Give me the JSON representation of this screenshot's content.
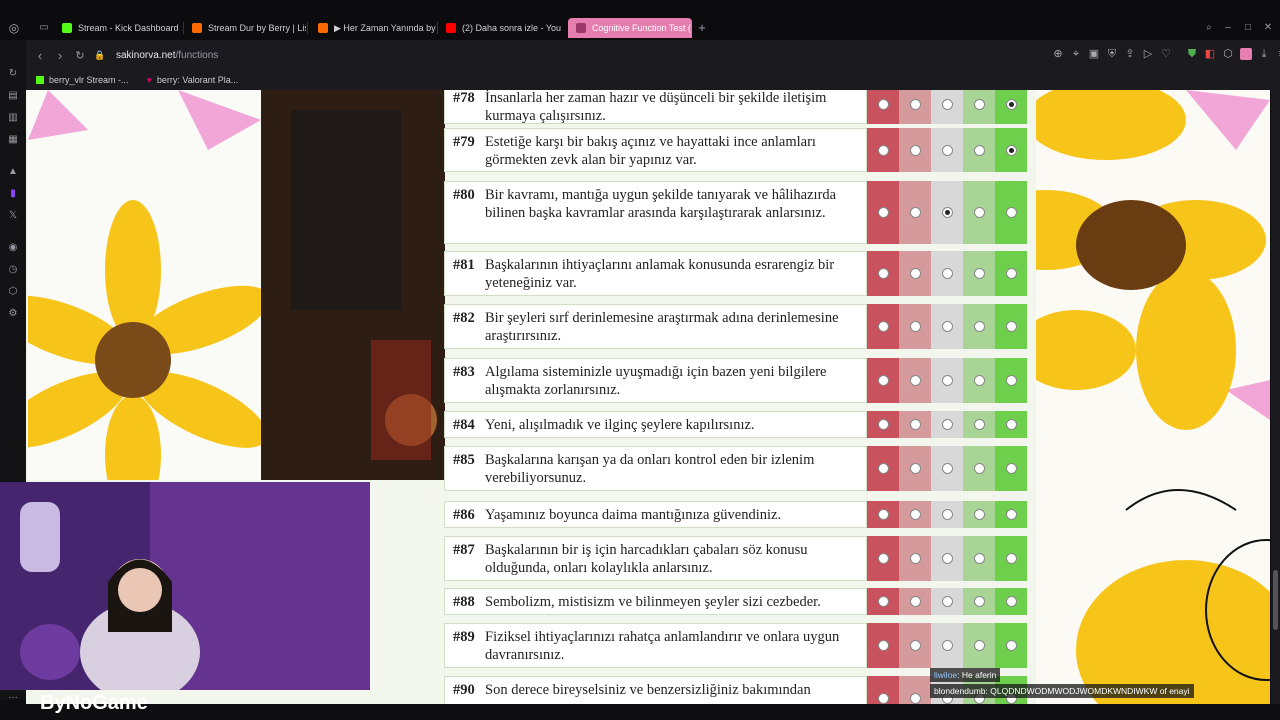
{
  "tabs": [
    {
      "label": "Stream - Kick Dashboard",
      "color": "#53fc18"
    },
    {
      "label": "Stream Dur by Berry | List",
      "color": "#ff6a00"
    },
    {
      "label": "▶ Her Zaman Yanında by",
      "color": "#ff6a00"
    },
    {
      "label": "(2) Daha sonra izle - You",
      "color": "#ff0000"
    },
    {
      "label": "Cognitive Function Test (",
      "color": "#e67eb0"
    }
  ],
  "address": {
    "domain": "sakinorva.net",
    "path": "/functions"
  },
  "bookmarks": [
    {
      "label": "berry_vlr Stream -..."
    },
    {
      "label": "berry: Valorant Pla..."
    }
  ],
  "questions": [
    {
      "num": "#78",
      "text": "İnsanlarla her zaman hazır ve düşünceli bir şekilde iletişim kurmaya çalışırsınız.",
      "selected": 4
    },
    {
      "num": "#79",
      "text": "Estetiğe karşı bir bakış açınız ve hayattaki ince anlamları görmekten zevk alan bir yapınız var.",
      "selected": 4
    },
    {
      "num": "#80",
      "text": "Bir kavramı, mantığa uygun şekilde tanıyarak ve hâlihazırda bilinen başka kavramlar arasında karşılaştırarak anlarsınız.",
      "selected": 2
    },
    {
      "num": "#81",
      "text": "Başkalarının ihtiyaçlarını anlamak konusunda esrarengiz bir yeteneğiniz var.",
      "selected": -1
    },
    {
      "num": "#82",
      "text": "Bir şeyleri sırf derinlemesine araştırmak adına derinlemesine araştırırsınız.",
      "selected": -1
    },
    {
      "num": "#83",
      "text": "Algılama sisteminizle uyuşmadığı için bazen yeni bilgilere alışmakta zorlanırsınız.",
      "selected": -1
    },
    {
      "num": "#84",
      "text": "Yeni, alışılmadık ve ilginç şeylere kapılırsınız.",
      "selected": -1
    },
    {
      "num": "#85",
      "text": "Başkalarına karışan ya da onları kontrol eden bir izlenim verebiliyorsunuz.",
      "selected": -1
    },
    {
      "num": "#86",
      "text": "Yaşamınız boyunca daima mantığınıza güvendiniz.",
      "selected": -1
    },
    {
      "num": "#87",
      "text": "Başkalarının bir iş için harcadıkları çabaları söz konusu olduğunda, onları kolaylıkla anlarsınız.",
      "selected": -1
    },
    {
      "num": "#88",
      "text": "Sembolizm, mistisizm ve bilinmeyen şeyler sizi cezbeder.",
      "selected": -1
    },
    {
      "num": "#89",
      "text": "Fiziksel ihtiyaçlarınızı rahatça anlamlandırır ve onlara uygun davranırsınız.",
      "selected": -1
    },
    {
      "num": "#90",
      "text": "Son derece bireyselsiniz ve benzersizliğiniz bakımından",
      "selected": -1
    }
  ],
  "option_colors": [
    "#c9525f",
    "#d49a9c",
    "#d8d8d8",
    "#a8d496",
    "#6ecf4d"
  ],
  "overlay": {
    "logo": "ByNoGame"
  },
  "chat": [
    {
      "user": "liwiloe",
      "msg": ": He aferin"
    },
    {
      "user": "blondendumb",
      "msg": ": QLQDNDWODMWODJWOMDKWNDIWKW of enayi"
    }
  ]
}
